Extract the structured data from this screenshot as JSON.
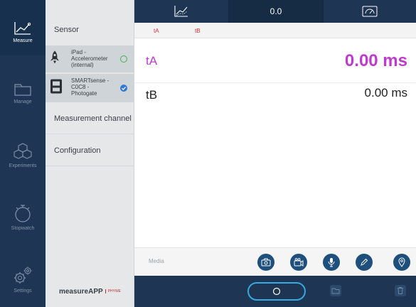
{
  "nav": {
    "items": [
      {
        "label": "Measure",
        "icon": "measure-graph-icon",
        "active": true
      },
      {
        "label": "Manage",
        "icon": "folder-icon",
        "active": false
      },
      {
        "label": "Experiments",
        "icon": "experiments-cubes-icon",
        "active": false
      },
      {
        "label": "Stopwatch",
        "icon": "stopwatch-icon",
        "active": false
      },
      {
        "label": "Settings",
        "icon": "gear-icon",
        "active": false
      }
    ]
  },
  "panel": {
    "title": "Sensor",
    "sensors": [
      {
        "name": "iPad - Accelerometer (internal)",
        "line1": "iPad -",
        "line2": "Accelerometer",
        "line3": "(internal)",
        "icon": "rocket-icon",
        "state": "available"
      },
      {
        "name": "SMARTsense - C0C8 - Photogate",
        "line1": "SMARTsense -",
        "line2": "C0C8 -",
        "line3": "Photogate",
        "icon": "photogate-icon",
        "state": "connected"
      }
    ],
    "links": [
      "Measurement channel",
      "Configuration"
    ],
    "brand": {
      "main": "measureAPP",
      "partner": "PHYWE"
    }
  },
  "topbar": {
    "tabs": [
      {
        "type": "icon",
        "icon": "graph-view-icon"
      },
      {
        "type": "text",
        "label": "0.0",
        "active": true
      },
      {
        "type": "icon",
        "icon": "gauge-view-icon"
      }
    ]
  },
  "channels": [
    "tA",
    "tB"
  ],
  "measurements": [
    {
      "label": "tA",
      "value": "0.00 ms",
      "color": "#c03ad0"
    },
    {
      "label": "tB",
      "value": "0.00 ms",
      "color": "#222222"
    }
  ],
  "media": {
    "label": "Media",
    "buttons": [
      "camera-icon",
      "video-icon",
      "microphone-icon",
      "pencil-icon",
      "location-pin-icon"
    ]
  },
  "colors": {
    "accent": "#35a9e0",
    "nav_bg": "#1e3653",
    "highlight": "#c03ad0",
    "channel_text": "#d0303a"
  }
}
